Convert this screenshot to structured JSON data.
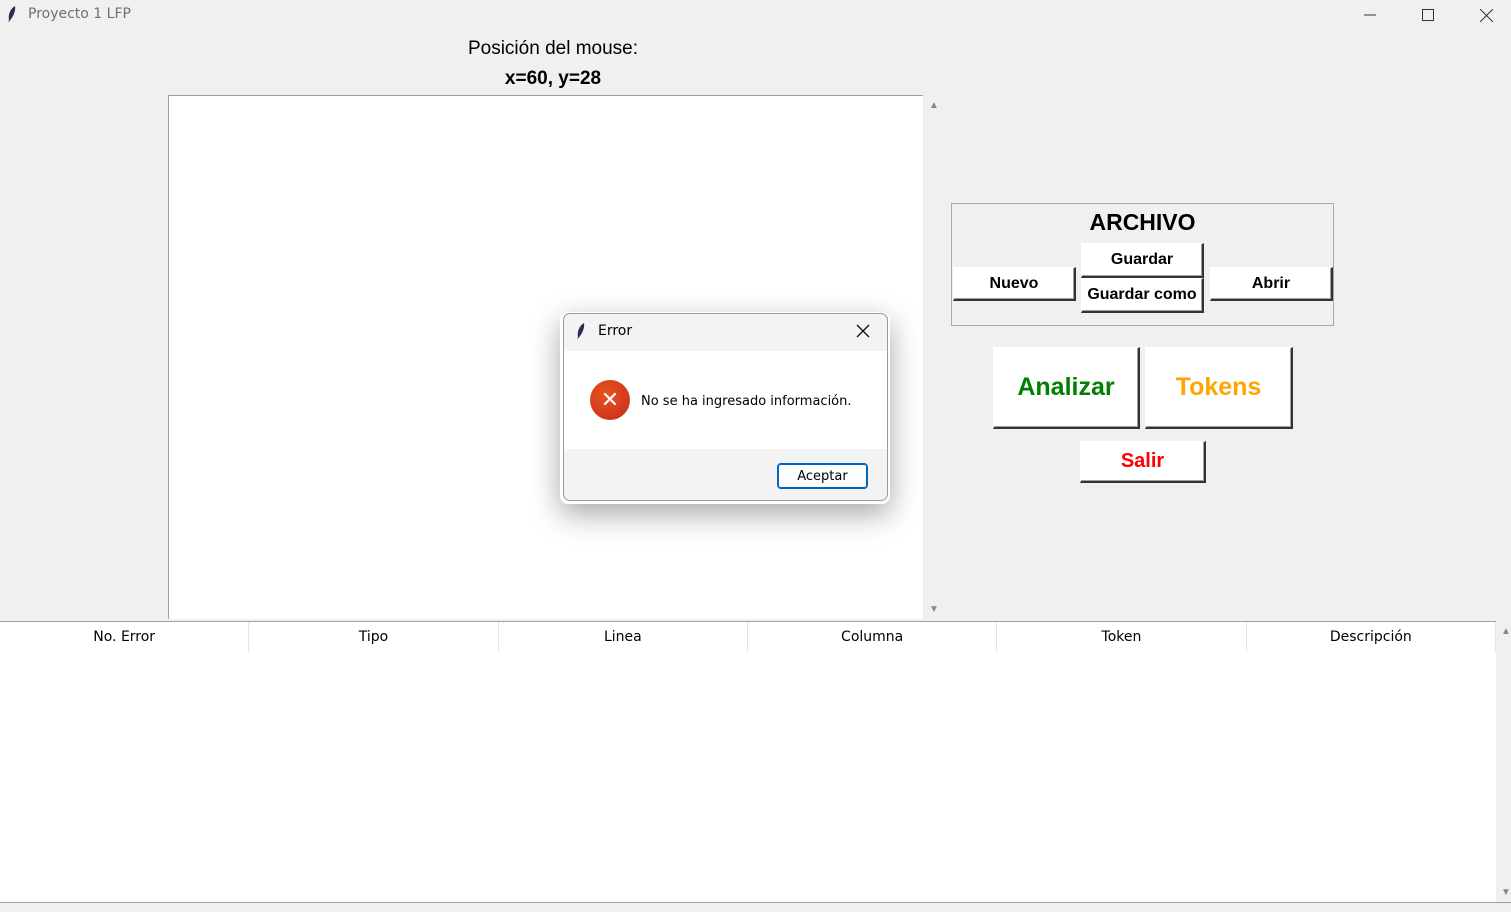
{
  "window": {
    "title": "Proyecto 1 LFP"
  },
  "mouse": {
    "label": "Posición del mouse:",
    "coords": "x=60, y=28"
  },
  "archivo": {
    "title": "ARCHIVO",
    "nuevo": "Nuevo",
    "guardar": "Guardar",
    "guardar_como": "Guardar como",
    "abrir": "Abrir"
  },
  "actions": {
    "analizar": "Analizar",
    "tokens": "Tokens",
    "salir": "Salir",
    "colors": {
      "analizar": "#008000",
      "tokens": "#ffa500",
      "salir": "#ff0000"
    }
  },
  "table": {
    "columns": [
      "No. Error",
      "Tipo",
      "Linea",
      "Columna",
      "Token",
      "Descripción"
    ],
    "rows": []
  },
  "dialog": {
    "title": "Error",
    "message": "No se ha ingresado información.",
    "ok_label": "Aceptar",
    "icon": "error-icon"
  }
}
